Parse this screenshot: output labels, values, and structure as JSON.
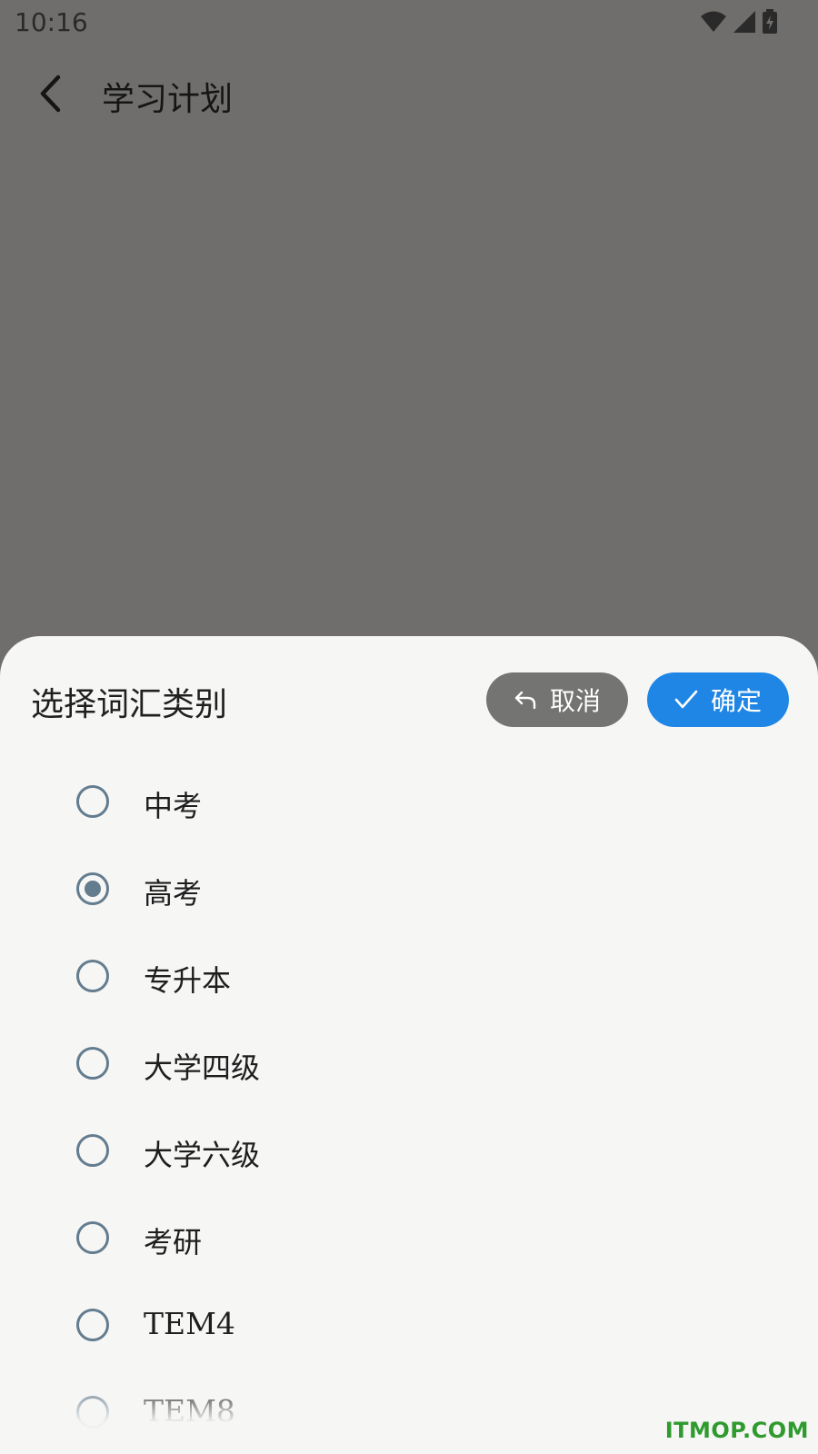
{
  "status_bar": {
    "time": "10:16",
    "icons": [
      "wifi-icon",
      "signal-icon",
      "battery-charging-icon"
    ]
  },
  "app_bar": {
    "back_icon": "chevron-left-icon",
    "title": "学习计划"
  },
  "sheet": {
    "title": "选择词汇类别",
    "cancel_label": "取消",
    "confirm_label": "确定",
    "colors": {
      "cancel_bg": "#747473",
      "confirm_bg": "#1f86e5",
      "radio": "#637c8e"
    },
    "options": [
      {
        "label": "中考",
        "selected": false
      },
      {
        "label": "高考",
        "selected": true
      },
      {
        "label": "专升本",
        "selected": false
      },
      {
        "label": "大学四级",
        "selected": false
      },
      {
        "label": "大学六级",
        "selected": false
      },
      {
        "label": "考研",
        "selected": false
      },
      {
        "label": "TEM4",
        "selected": false
      },
      {
        "label": "TEM8",
        "selected": false
      }
    ]
  },
  "watermark": "ITMOP.COM"
}
